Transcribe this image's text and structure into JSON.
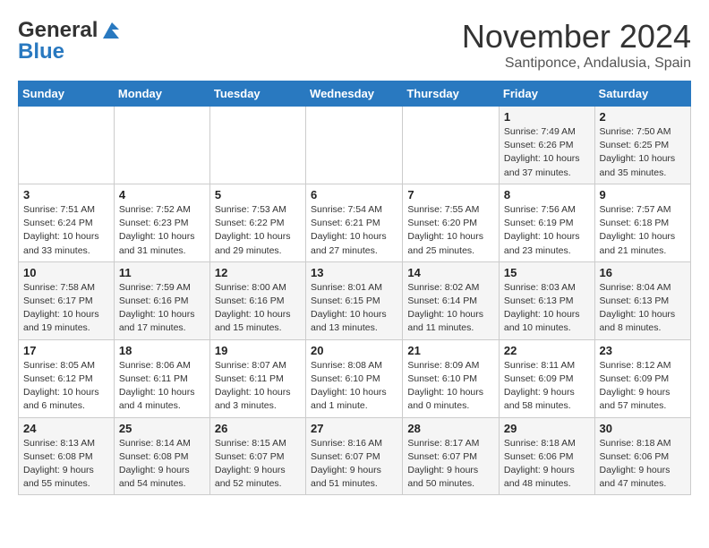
{
  "logo": {
    "line1": "General",
    "line2": "Blue"
  },
  "header": {
    "month": "November 2024",
    "location": "Santiponce, Andalusia, Spain"
  },
  "weekdays": [
    "Sunday",
    "Monday",
    "Tuesday",
    "Wednesday",
    "Thursday",
    "Friday",
    "Saturday"
  ],
  "weeks": [
    [
      {
        "day": "",
        "info": ""
      },
      {
        "day": "",
        "info": ""
      },
      {
        "day": "",
        "info": ""
      },
      {
        "day": "",
        "info": ""
      },
      {
        "day": "",
        "info": ""
      },
      {
        "day": "1",
        "info": "Sunrise: 7:49 AM\nSunset: 6:26 PM\nDaylight: 10 hours\nand 37 minutes."
      },
      {
        "day": "2",
        "info": "Sunrise: 7:50 AM\nSunset: 6:25 PM\nDaylight: 10 hours\nand 35 minutes."
      }
    ],
    [
      {
        "day": "3",
        "info": "Sunrise: 7:51 AM\nSunset: 6:24 PM\nDaylight: 10 hours\nand 33 minutes."
      },
      {
        "day": "4",
        "info": "Sunrise: 7:52 AM\nSunset: 6:23 PM\nDaylight: 10 hours\nand 31 minutes."
      },
      {
        "day": "5",
        "info": "Sunrise: 7:53 AM\nSunset: 6:22 PM\nDaylight: 10 hours\nand 29 minutes."
      },
      {
        "day": "6",
        "info": "Sunrise: 7:54 AM\nSunset: 6:21 PM\nDaylight: 10 hours\nand 27 minutes."
      },
      {
        "day": "7",
        "info": "Sunrise: 7:55 AM\nSunset: 6:20 PM\nDaylight: 10 hours\nand 25 minutes."
      },
      {
        "day": "8",
        "info": "Sunrise: 7:56 AM\nSunset: 6:19 PM\nDaylight: 10 hours\nand 23 minutes."
      },
      {
        "day": "9",
        "info": "Sunrise: 7:57 AM\nSunset: 6:18 PM\nDaylight: 10 hours\nand 21 minutes."
      }
    ],
    [
      {
        "day": "10",
        "info": "Sunrise: 7:58 AM\nSunset: 6:17 PM\nDaylight: 10 hours\nand 19 minutes."
      },
      {
        "day": "11",
        "info": "Sunrise: 7:59 AM\nSunset: 6:16 PM\nDaylight: 10 hours\nand 17 minutes."
      },
      {
        "day": "12",
        "info": "Sunrise: 8:00 AM\nSunset: 6:16 PM\nDaylight: 10 hours\nand 15 minutes."
      },
      {
        "day": "13",
        "info": "Sunrise: 8:01 AM\nSunset: 6:15 PM\nDaylight: 10 hours\nand 13 minutes."
      },
      {
        "day": "14",
        "info": "Sunrise: 8:02 AM\nSunset: 6:14 PM\nDaylight: 10 hours\nand 11 minutes."
      },
      {
        "day": "15",
        "info": "Sunrise: 8:03 AM\nSunset: 6:13 PM\nDaylight: 10 hours\nand 10 minutes."
      },
      {
        "day": "16",
        "info": "Sunrise: 8:04 AM\nSunset: 6:13 PM\nDaylight: 10 hours\nand 8 minutes."
      }
    ],
    [
      {
        "day": "17",
        "info": "Sunrise: 8:05 AM\nSunset: 6:12 PM\nDaylight: 10 hours\nand 6 minutes."
      },
      {
        "day": "18",
        "info": "Sunrise: 8:06 AM\nSunset: 6:11 PM\nDaylight: 10 hours\nand 4 minutes."
      },
      {
        "day": "19",
        "info": "Sunrise: 8:07 AM\nSunset: 6:11 PM\nDaylight: 10 hours\nand 3 minutes."
      },
      {
        "day": "20",
        "info": "Sunrise: 8:08 AM\nSunset: 6:10 PM\nDaylight: 10 hours\nand 1 minute."
      },
      {
        "day": "21",
        "info": "Sunrise: 8:09 AM\nSunset: 6:10 PM\nDaylight: 10 hours\nand 0 minutes."
      },
      {
        "day": "22",
        "info": "Sunrise: 8:11 AM\nSunset: 6:09 PM\nDaylight: 9 hours\nand 58 minutes."
      },
      {
        "day": "23",
        "info": "Sunrise: 8:12 AM\nSunset: 6:09 PM\nDaylight: 9 hours\nand 57 minutes."
      }
    ],
    [
      {
        "day": "24",
        "info": "Sunrise: 8:13 AM\nSunset: 6:08 PM\nDaylight: 9 hours\nand 55 minutes."
      },
      {
        "day": "25",
        "info": "Sunrise: 8:14 AM\nSunset: 6:08 PM\nDaylight: 9 hours\nand 54 minutes."
      },
      {
        "day": "26",
        "info": "Sunrise: 8:15 AM\nSunset: 6:07 PM\nDaylight: 9 hours\nand 52 minutes."
      },
      {
        "day": "27",
        "info": "Sunrise: 8:16 AM\nSunset: 6:07 PM\nDaylight: 9 hours\nand 51 minutes."
      },
      {
        "day": "28",
        "info": "Sunrise: 8:17 AM\nSunset: 6:07 PM\nDaylight: 9 hours\nand 50 minutes."
      },
      {
        "day": "29",
        "info": "Sunrise: 8:18 AM\nSunset: 6:06 PM\nDaylight: 9 hours\nand 48 minutes."
      },
      {
        "day": "30",
        "info": "Sunrise: 8:18 AM\nSunset: 6:06 PM\nDaylight: 9 hours\nand 47 minutes."
      }
    ]
  ]
}
